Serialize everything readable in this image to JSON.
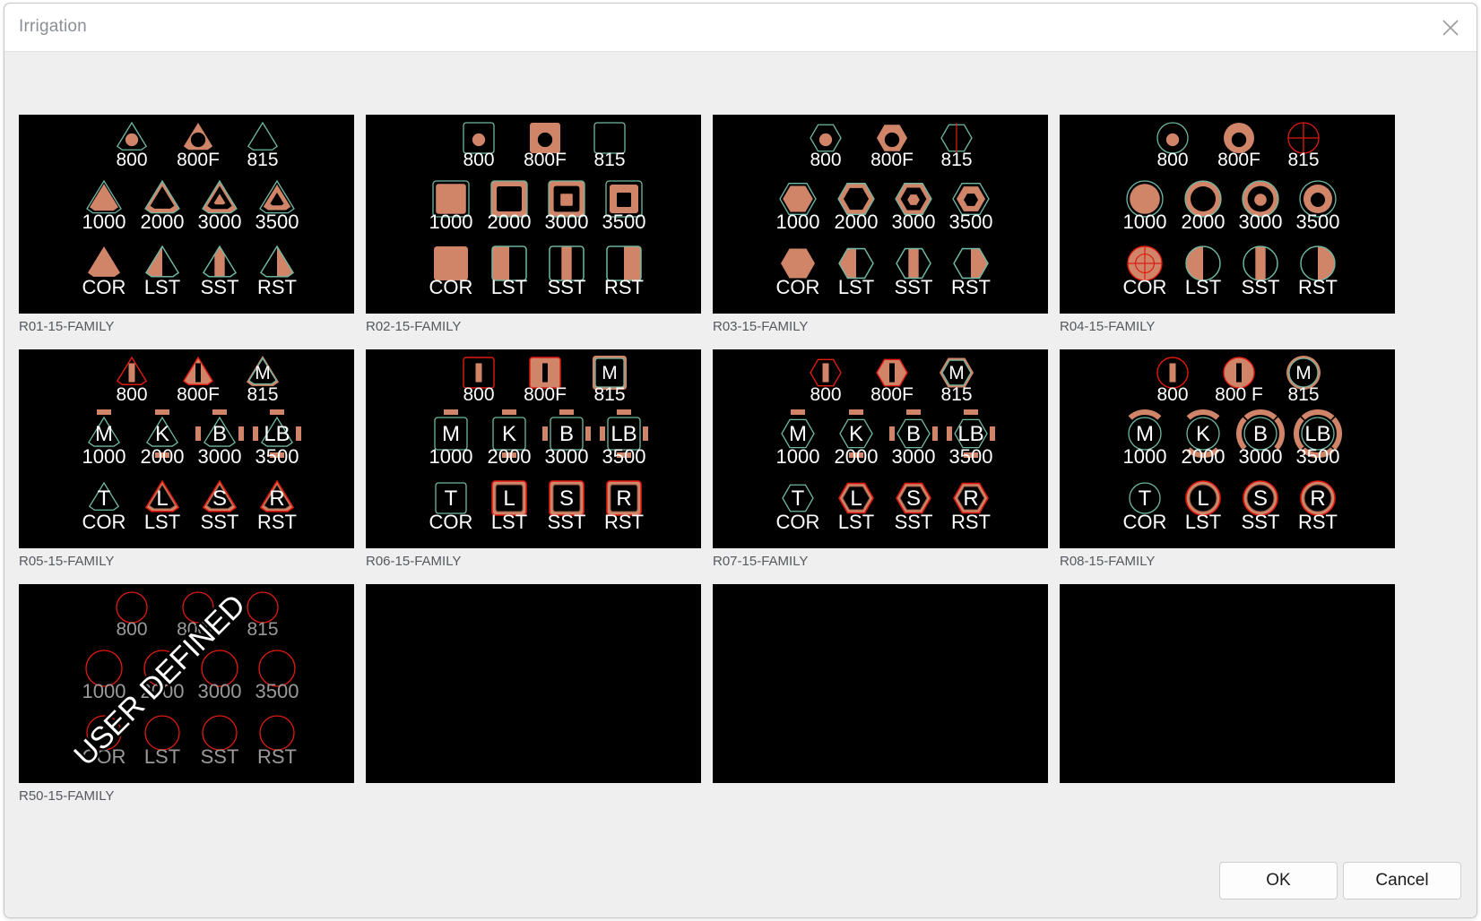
{
  "dialog": {
    "title": "Irrigation",
    "close_icon": "close-icon"
  },
  "footer": {
    "ok_label": "OK",
    "cancel_label": "Cancel"
  },
  "colors": {
    "thumb_background": "#000000",
    "salmon": "#d08468",
    "teal": "#6fb8a4",
    "red": "#e01b10",
    "white": "#ffffff",
    "gray_label": "#9a9a9a",
    "caption_text": "#56595e",
    "dialog_background": "#efeff0",
    "titlebar_background": "#ffffff"
  },
  "labels": {
    "row1": [
      "800",
      "800F",
      "815"
    ],
    "row1_alt": [
      "800",
      "800 F",
      "815"
    ],
    "row2": [
      "1000",
      "2000",
      "3000",
      "3500"
    ],
    "row3": [
      "COR",
      "LST",
      "SST",
      "RST"
    ]
  },
  "letters": {
    "row1": [
      "",
      "",
      "M"
    ],
    "row2": [
      "M",
      "K",
      "B",
      "LB"
    ],
    "row3": [
      "T",
      "L",
      "S",
      "R"
    ]
  },
  "panels": [
    {
      "caption": "R01-15-FAMILY",
      "style": "triangle",
      "empty": false,
      "has_letters": false,
      "row1_labels": [
        "800",
        "800F",
        "815"
      ],
      "row2_labels": [
        "1000",
        "2000",
        "3000",
        "3500"
      ],
      "row3_labels": [
        "COR",
        "LST",
        "SST",
        "RST"
      ]
    },
    {
      "caption": "R02-15-FAMILY",
      "style": "square",
      "empty": false,
      "has_letters": false,
      "row1_labels": [
        "800",
        "800F",
        "815"
      ],
      "row2_labels": [
        "1000",
        "2000",
        "3000",
        "3500"
      ],
      "row3_labels": [
        "COR",
        "LST",
        "SST",
        "RST"
      ]
    },
    {
      "caption": "R03-15-FAMILY",
      "style": "hexagon",
      "empty": false,
      "has_letters": false,
      "row1_labels": [
        "800",
        "800F",
        "815"
      ],
      "row2_labels": [
        "1000",
        "2000",
        "3000",
        "3500"
      ],
      "row3_labels": [
        "COR",
        "LST",
        "SST",
        "RST"
      ]
    },
    {
      "caption": "R04-15-FAMILY",
      "style": "circle",
      "empty": false,
      "has_letters": false,
      "row1_labels": [
        "800",
        "800F",
        "815"
      ],
      "row2_labels": [
        "1000",
        "2000",
        "3000",
        "3500"
      ],
      "row3_labels": [
        "COR",
        "LST",
        "SST",
        "RST"
      ]
    },
    {
      "caption": "R05-15-FAMILY",
      "style": "triangle",
      "empty": false,
      "has_letters": true,
      "row1_labels": [
        "800",
        "800F",
        "815"
      ],
      "row2_labels": [
        "1000",
        "2000",
        "3000",
        "3500"
      ],
      "row3_labels": [
        "COR",
        "LST",
        "SST",
        "RST"
      ]
    },
    {
      "caption": "R06-15-FAMILY",
      "style": "square",
      "empty": false,
      "has_letters": true,
      "row1_labels": [
        "800",
        "800F",
        "815"
      ],
      "row2_labels": [
        "1000",
        "2000",
        "3000",
        "3500"
      ],
      "row3_labels": [
        "COR",
        "LST",
        "SST",
        "RST"
      ]
    },
    {
      "caption": "R07-15-FAMILY",
      "style": "hexagon",
      "empty": false,
      "has_letters": true,
      "row1_labels": [
        "800",
        "800F",
        "815"
      ],
      "row2_labels": [
        "1000",
        "2000",
        "3000",
        "3500"
      ],
      "row3_labels": [
        "COR",
        "LST",
        "SST",
        "RST"
      ]
    },
    {
      "caption": "R08-15-FAMILY",
      "style": "circle",
      "empty": false,
      "has_letters": true,
      "row1_labels": [
        "800",
        "800 F",
        "815"
      ],
      "row2_labels": [
        "1000",
        "2000",
        "3000",
        "3500"
      ],
      "row3_labels": [
        "COR",
        "LST",
        "SST",
        "RST"
      ]
    },
    {
      "caption": "R50-15-FAMILY",
      "style": "userdefined",
      "empty": false,
      "has_letters": false,
      "watermark": "USER DEFINED",
      "row1_labels": [
        "800",
        "800F",
        "815"
      ],
      "row2_labels": [
        "1000",
        "2000",
        "3000",
        "3500"
      ],
      "row3_labels": [
        "COR",
        "LST",
        "SST",
        "RST"
      ]
    },
    {
      "caption": "",
      "style": "empty",
      "empty": true,
      "has_letters": false
    },
    {
      "caption": "",
      "style": "empty",
      "empty": true,
      "has_letters": false
    },
    {
      "caption": "",
      "style": "empty",
      "empty": true,
      "has_letters": false
    }
  ]
}
